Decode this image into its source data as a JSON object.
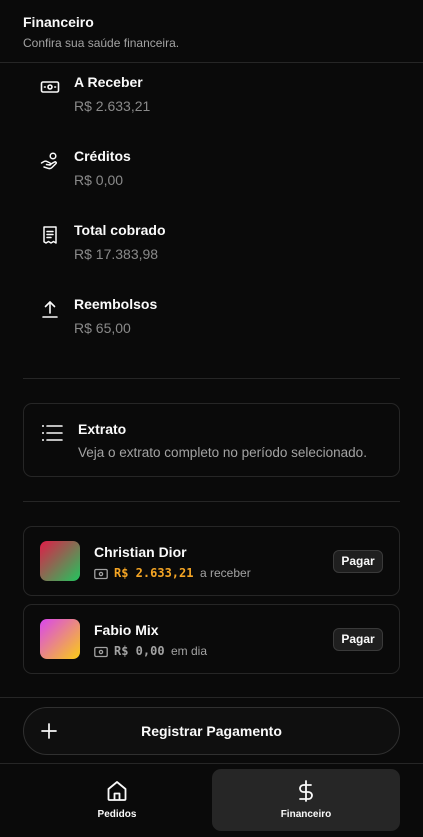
{
  "header": {
    "title": "Financeiro",
    "subtitle": "Confira sua saúde financeira."
  },
  "stats": [
    {
      "label": "A Receber",
      "value": "R$ 2.633,21",
      "icon": "banknote-icon"
    },
    {
      "label": "Créditos",
      "value": "R$ 0,00",
      "icon": "hand-coins-icon"
    },
    {
      "label": "Total cobrado",
      "value": "R$ 17.383,98",
      "icon": "receipt-icon"
    },
    {
      "label": "Reembolsos",
      "value": "R$ 65,00",
      "icon": "upload-arrow-icon"
    }
  ],
  "extrato": {
    "label": "Extrato",
    "description": "Veja o extrato completo no período selecionado.",
    "icon": "list-icon"
  },
  "clients": [
    {
      "name": "Christian Dior",
      "amount": "R$ 2.633,21",
      "status": "a receber",
      "pay_label": "Pagar",
      "amount_color": "#f5a524",
      "avatar_gradient": [
        "#e11d48",
        "#22c55e"
      ]
    },
    {
      "name": "Fabio Mix",
      "amount": "R$ 0,00",
      "status": "em dia",
      "pay_label": "Pagar",
      "amount_color": "#a3a3a3",
      "avatar_gradient": [
        "#d946ef",
        "#facc15"
      ]
    }
  ],
  "register_button": {
    "label": "Registrar Pagamento",
    "icon": "plus-icon"
  },
  "nav": [
    {
      "label": "Pedidos",
      "icon": "home-icon",
      "active": false
    },
    {
      "label": "Financeiro",
      "icon": "dollar-icon",
      "active": true
    }
  ],
  "colors": {
    "background": "#0a0a0a",
    "border": "#262626",
    "muted": "#a3a3a3",
    "accent": "#f5a524"
  }
}
